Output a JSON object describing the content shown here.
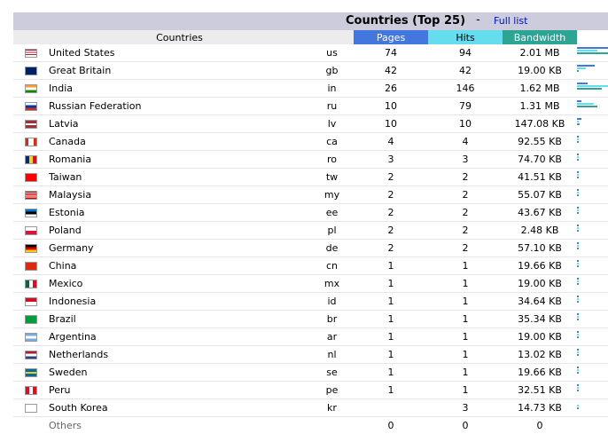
{
  "header": {
    "title": "Countries (Top 25)",
    "separator": "-",
    "full_list": "Full list"
  },
  "columns": {
    "countries": "Countries",
    "pages": "Pages",
    "hits": "Hits",
    "bandwidth": "Bandwidth"
  },
  "colors": {
    "pages": "#4477dd",
    "hits": "#66ddee",
    "bandwidth": "#2ea495",
    "header_bg": "#ccccdd"
  },
  "rows": [
    {
      "name": "United States",
      "code": "us",
      "pages": "74",
      "hits": "94",
      "bandwidth": "2.01 MB",
      "flag": "us-flag-icon"
    },
    {
      "name": "Great Britain",
      "code": "gb",
      "pages": "42",
      "hits": "42",
      "bandwidth": "19.00 KB",
      "flag": "gb-flag-icon"
    },
    {
      "name": "India",
      "code": "in",
      "pages": "26",
      "hits": "146",
      "bandwidth": "1.62 MB",
      "flag": "in-flag-icon"
    },
    {
      "name": "Russian Federation",
      "code": "ru",
      "pages": "10",
      "hits": "79",
      "bandwidth": "1.31 MB",
      "flag": "ru-flag-icon"
    },
    {
      "name": "Latvia",
      "code": "lv",
      "pages": "10",
      "hits": "10",
      "bandwidth": "147.08 KB",
      "flag": "lv-flag-icon"
    },
    {
      "name": "Canada",
      "code": "ca",
      "pages": "4",
      "hits": "4",
      "bandwidth": "92.55 KB",
      "flag": "ca-flag-icon"
    },
    {
      "name": "Romania",
      "code": "ro",
      "pages": "3",
      "hits": "3",
      "bandwidth": "74.70 KB",
      "flag": "ro-flag-icon"
    },
    {
      "name": "Taiwan",
      "code": "tw",
      "pages": "2",
      "hits": "2",
      "bandwidth": "41.51 KB",
      "flag": "tw-flag-icon"
    },
    {
      "name": "Malaysia",
      "code": "my",
      "pages": "2",
      "hits": "2",
      "bandwidth": "55.07 KB",
      "flag": "my-flag-icon"
    },
    {
      "name": "Estonia",
      "code": "ee",
      "pages": "2",
      "hits": "2",
      "bandwidth": "43.67 KB",
      "flag": "ee-flag-icon"
    },
    {
      "name": "Poland",
      "code": "pl",
      "pages": "2",
      "hits": "2",
      "bandwidth": "2.48 KB",
      "flag": "pl-flag-icon"
    },
    {
      "name": "Germany",
      "code": "de",
      "pages": "2",
      "hits": "2",
      "bandwidth": "57.10 KB",
      "flag": "de-flag-icon"
    },
    {
      "name": "China",
      "code": "cn",
      "pages": "1",
      "hits": "1",
      "bandwidth": "19.66 KB",
      "flag": "cn-flag-icon"
    },
    {
      "name": "Mexico",
      "code": "mx",
      "pages": "1",
      "hits": "1",
      "bandwidth": "19.00 KB",
      "flag": "mx-flag-icon"
    },
    {
      "name": "Indonesia",
      "code": "id",
      "pages": "1",
      "hits": "1",
      "bandwidth": "34.64 KB",
      "flag": "id-flag-icon"
    },
    {
      "name": "Brazil",
      "code": "br",
      "pages": "1",
      "hits": "1",
      "bandwidth": "35.34 KB",
      "flag": "br-flag-icon"
    },
    {
      "name": "Argentina",
      "code": "ar",
      "pages": "1",
      "hits": "1",
      "bandwidth": "19.00 KB",
      "flag": "ar-flag-icon"
    },
    {
      "name": "Netherlands",
      "code": "nl",
      "pages": "1",
      "hits": "1",
      "bandwidth": "13.02 KB",
      "flag": "nl-flag-icon"
    },
    {
      "name": "Sweden",
      "code": "se",
      "pages": "1",
      "hits": "1",
      "bandwidth": "19.66 KB",
      "flag": "se-flag-icon"
    },
    {
      "name": "Peru",
      "code": "pe",
      "pages": "1",
      "hits": "1",
      "bandwidth": "32.51 KB",
      "flag": "pe-flag-icon"
    },
    {
      "name": "South Korea",
      "code": "kr",
      "pages": "",
      "hits": "3",
      "bandwidth": "14.73 KB",
      "flag": "kr-flag-icon"
    }
  ],
  "others": {
    "name": "Others",
    "pages": "0",
    "hits": "0",
    "bandwidth": "0"
  }
}
